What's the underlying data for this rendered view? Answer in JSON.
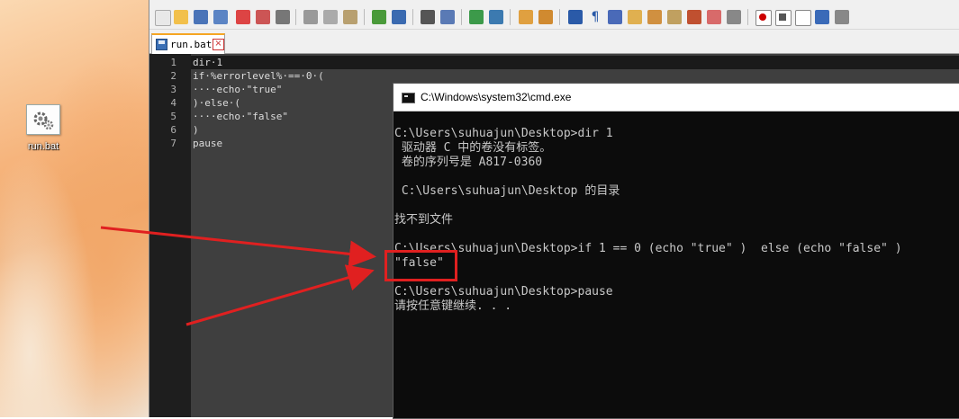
{
  "desktop": {
    "icon_label": "run.bat"
  },
  "editor": {
    "tab_name": "run.bat",
    "lines": [
      {
        "num": "1",
        "text": "dir·1"
      },
      {
        "num": "2",
        "text": "if·%errorlevel%·==·0·("
      },
      {
        "num": "3",
        "text": "····echo·\"true\""
      },
      {
        "num": "4",
        "text": ")·else·("
      },
      {
        "num": "5",
        "text": "····echo·\"false\""
      },
      {
        "num": "6",
        "text": ")"
      },
      {
        "num": "7",
        "text": "pause"
      }
    ]
  },
  "cmd": {
    "title": "C:\\Windows\\system32\\cmd.exe",
    "lines": [
      "C:\\Users\\suhuajun\\Desktop>dir 1",
      " 驱动器 C 中的卷没有标签。",
      " 卷的序列号是 A817-0360",
      "",
      " C:\\Users\\suhuajun\\Desktop 的目录",
      "",
      "找不到文件",
      "",
      "C:\\Users\\suhuajun\\Desktop>if 1 == 0 (echo \"true\" )  else (echo \"false\" )",
      "\"false\"",
      "",
      "C:\\Users\\suhuajun\\Desktop>pause",
      "请按任意键继续. . ."
    ]
  },
  "colors": {
    "annotation": "#e02020",
    "tab_accent": "#f5a623"
  }
}
